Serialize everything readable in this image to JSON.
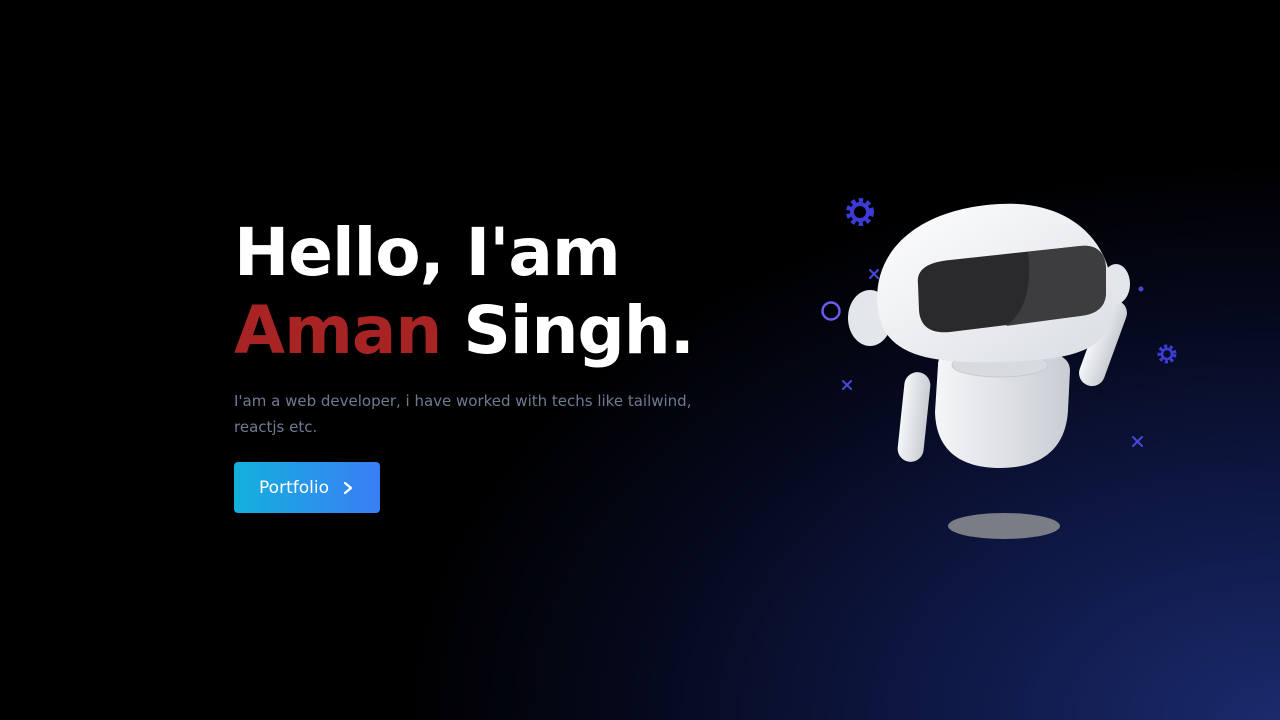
{
  "hero": {
    "greeting": "Hello, I'am",
    "name_first": "Aman",
    "name_rest": " Singh.",
    "description": "I'am a web developer, i have worked with techs like tailwind, reactjs etc.",
    "cta_label": "Portfolio",
    "cta_icon": "chevron-right-icon"
  },
  "illustration": {
    "subject": "robot",
    "decorations": [
      "gear-icon",
      "gear-icon",
      "circle-icon",
      "cross-icon",
      "cross-icon",
      "cross-icon",
      "dot-icon"
    ]
  },
  "colors": {
    "accent_name": "#a82424",
    "button_start": "#13b0dc",
    "button_end": "#3a7ef5",
    "background_glow": "#1a2a6c",
    "decoration": "#3b3bd6"
  }
}
